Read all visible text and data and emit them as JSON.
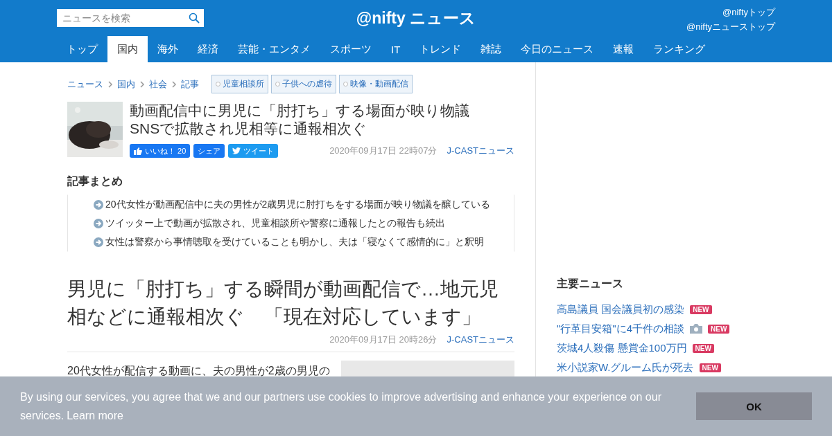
{
  "search": {
    "placeholder": "ニュースを検索"
  },
  "logo": "@nifty ニュース",
  "header_links": [
    "@niftyトップ",
    "@niftyニューストップ"
  ],
  "nav": [
    {
      "label": "トップ",
      "selected": false
    },
    {
      "label": "国内",
      "selected": true
    },
    {
      "label": "海外",
      "selected": false
    },
    {
      "label": "経済",
      "selected": false
    },
    {
      "label": "芸能・エンタメ",
      "selected": false
    },
    {
      "label": "スポーツ",
      "selected": false
    },
    {
      "label": "IT",
      "selected": false
    },
    {
      "label": "トレンド",
      "selected": false
    },
    {
      "label": "雑誌",
      "selected": false
    },
    {
      "label": "今日のニュース",
      "selected": false
    },
    {
      "label": "速報",
      "selected": false
    },
    {
      "label": "ランキング",
      "selected": false
    }
  ],
  "breadcrumbs": [
    "ニュース",
    "国内",
    "社会",
    "記事"
  ],
  "tags": [
    "児童相談所",
    "子供への虐待",
    "映像・動画配信"
  ],
  "article": {
    "title_lines": [
      "動画配信中に男児に「肘打ち」する場面が映り物議",
      "SNSで拡散され児相等に通報相次ぐ"
    ],
    "like_label": "いいね！",
    "like_count": "20",
    "share_label": "シェア",
    "tweet_label": "ツイート",
    "date": "2020年09月17日 22時07分",
    "source": "J-CASTニュース"
  },
  "summary": {
    "heading": "記事まとめ",
    "items": [
      "20代女性が動画配信中に夫の男性が2歳男児に肘打ちをする場面が映り物議を醸している",
      "ツイッター上で動画が拡散され、児童相談所や警察に通報したとの報告も続出",
      "女性は警察から事情聴取を受けていることも明かし、夫は「寝なくて感情的に」と釈明"
    ]
  },
  "story": {
    "headline": "男児に「肘打ち」する瞬間が動画配信で…地元児相などに通報相次ぐ　「現在対応しています」",
    "date": "2020年09月17日 20時26分",
    "source": "J-CASTニュース",
    "body": "20代女性が配信する動画に、夫の男性が2歳の男児の"
  },
  "sidebar": {
    "heading": "主要ニュース",
    "items": [
      {
        "title": "高島議員 国会議員初の感染",
        "has_photo": false,
        "badge": "NEW"
      },
      {
        "title": "\"行革目安箱\"に4千件の相談",
        "has_photo": true,
        "badge": "NEW"
      },
      {
        "title": "茨城4人殺傷 懸賞金100万円",
        "has_photo": false,
        "badge": "NEW"
      },
      {
        "title": "米小説家W.グルーム氏が死去",
        "has_photo": false,
        "badge": "NEW"
      }
    ]
  },
  "cookie": {
    "text": "By using our services, you agree that we and our partners use cookies to improve advertising and enhance your experience on our services.",
    "link": "Learn more",
    "button": "OK"
  }
}
